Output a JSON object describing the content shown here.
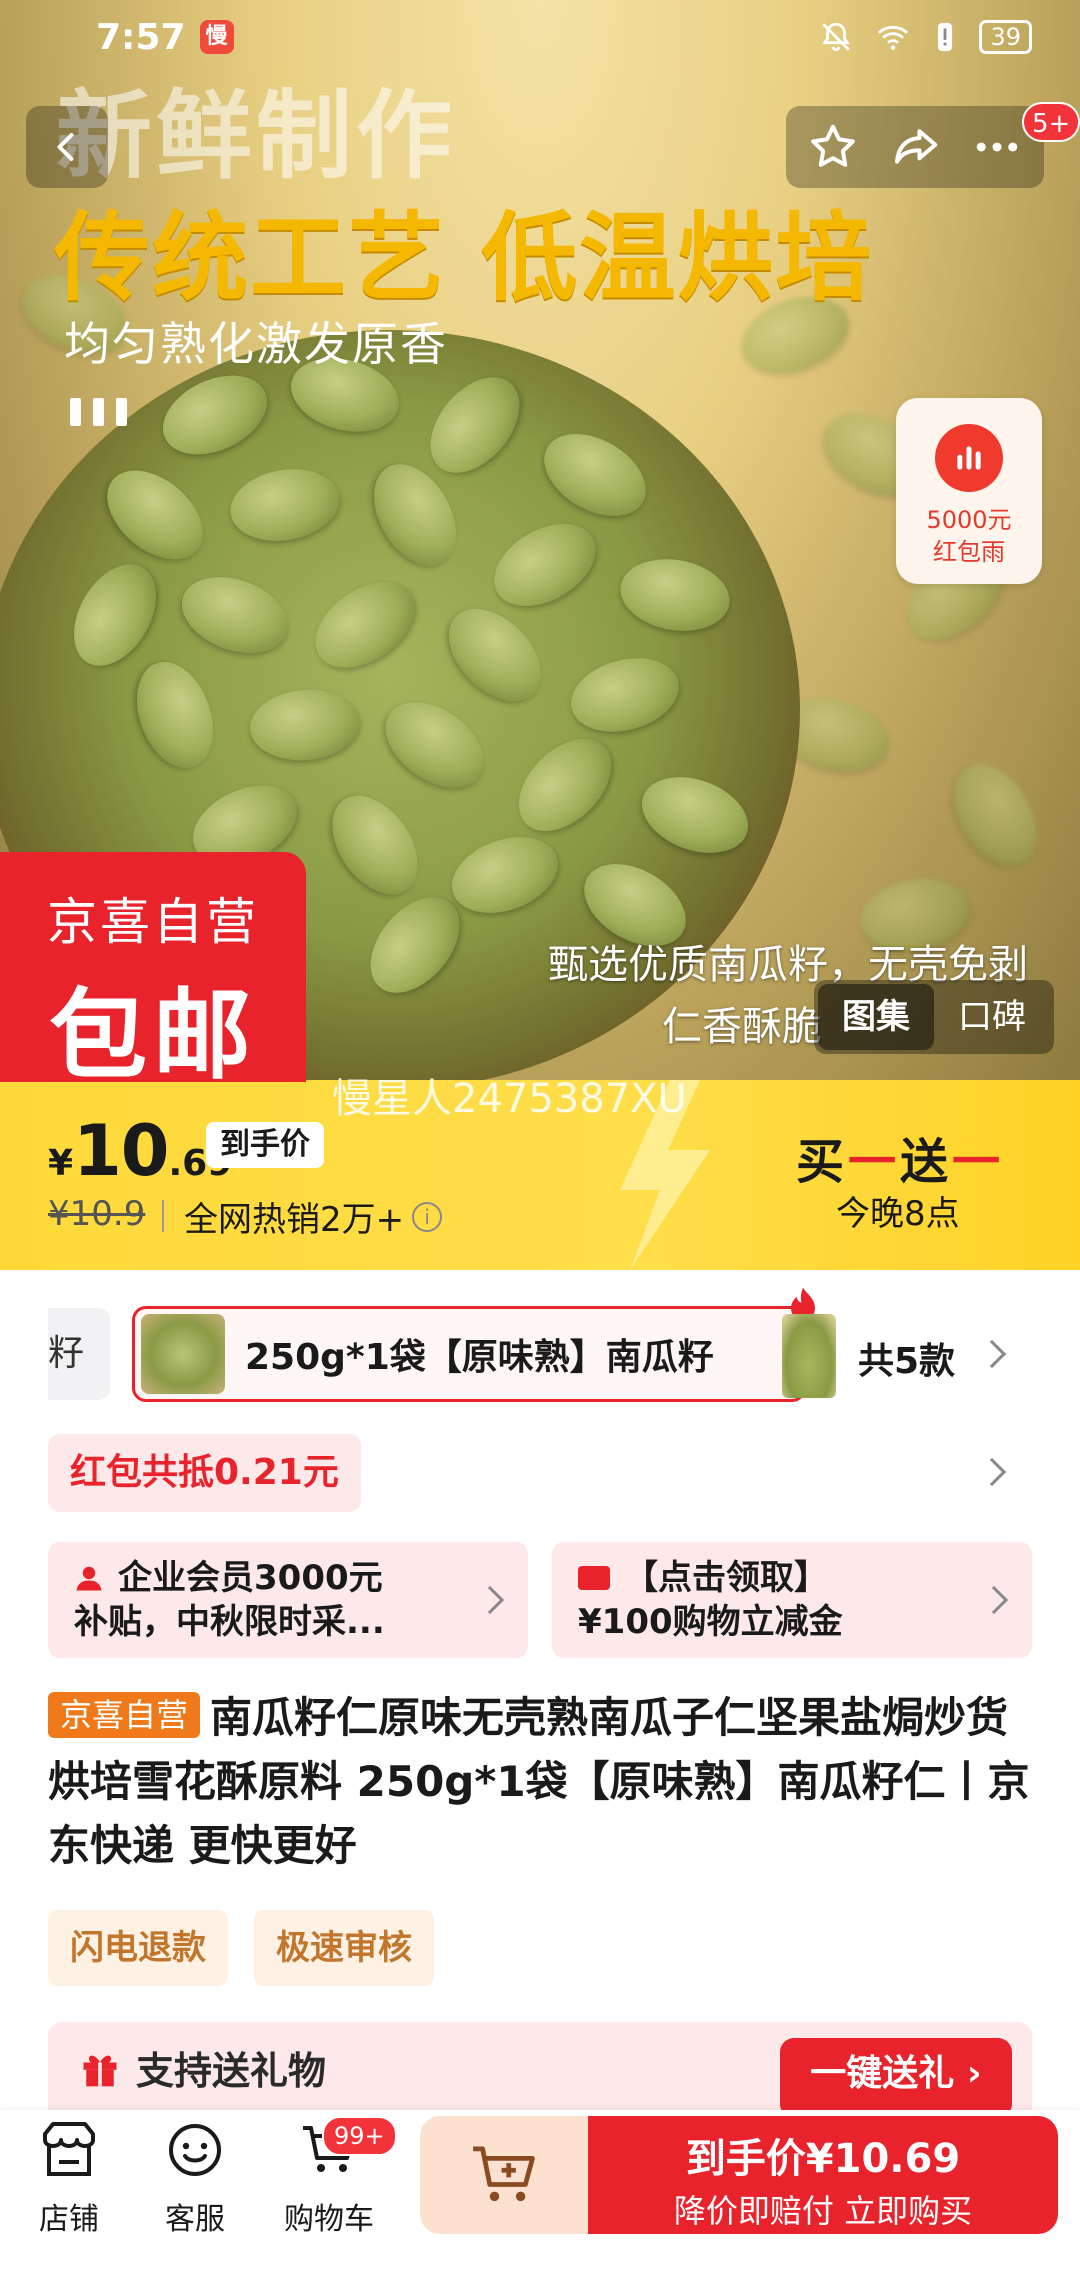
{
  "status_bar": {
    "time": "7:57",
    "app_badge": "慢",
    "battery": "39"
  },
  "hero": {
    "text_line1": "新鲜制作",
    "text_line2": "传统工艺 低温烘培",
    "text_line3": "均匀熟化激发原香",
    "text_line4": "甄选优质南瓜籽，无壳免剥",
    "text_line5": "仁香酥脆",
    "message_count": "5+",
    "redpack": {
      "line1": "5000元",
      "line2": "红包雨"
    },
    "jx_badge": {
      "line1": "京喜自营",
      "line2": "包邮"
    },
    "tabs": [
      {
        "label": "图集",
        "active": true
      },
      {
        "label": "口碑",
        "active": false
      }
    ],
    "watermark": "慢星人2475387XU"
  },
  "price": {
    "currency": "¥",
    "integer": "10",
    "decimal": ".69",
    "tag": "到手价",
    "original": "¥10.9",
    "sales": "全网热销2万+",
    "promo": {
      "left": "买",
      "right": "送",
      "sub": "今晚8点"
    }
  },
  "variants": {
    "prev_partial": "籽",
    "selected": "250g*1袋【原味熟】南瓜籽",
    "count": "共5款"
  },
  "redpack_row": "红包共抵0.21元",
  "coupons": [
    {
      "line1": "企业会员3000元",
      "line2": "补贴，中秋限时采..."
    },
    {
      "line1": "【点击领取】",
      "line2": "¥100购物立减金"
    }
  ],
  "product": {
    "tag": "京喜自营",
    "title": "南瓜籽仁原味无壳熟南瓜子仁坚果盐焗炒货烘培雪花酥原料 250g*1袋【原味熟】南瓜籽仁丨京东快递 更快更好"
  },
  "chips": [
    "闪电退款",
    "极速审核"
  ],
  "gift": {
    "label": "支持送礼物",
    "button": "一键送礼"
  },
  "bottom_bar": {
    "items": [
      {
        "label": "店铺",
        "icon": "store-icon"
      },
      {
        "label": "客服",
        "icon": "customer-service-icon"
      },
      {
        "label": "购物车",
        "icon": "cart-icon"
      }
    ],
    "cart_badge": "99+",
    "buy_line1": "到手价¥10.69",
    "buy_line2": "降价即赔付 立即购买"
  },
  "colors": {
    "accent_red": "#e8232c",
    "price_yellow": "#ffd93a",
    "seed_green": "#9fae58"
  }
}
